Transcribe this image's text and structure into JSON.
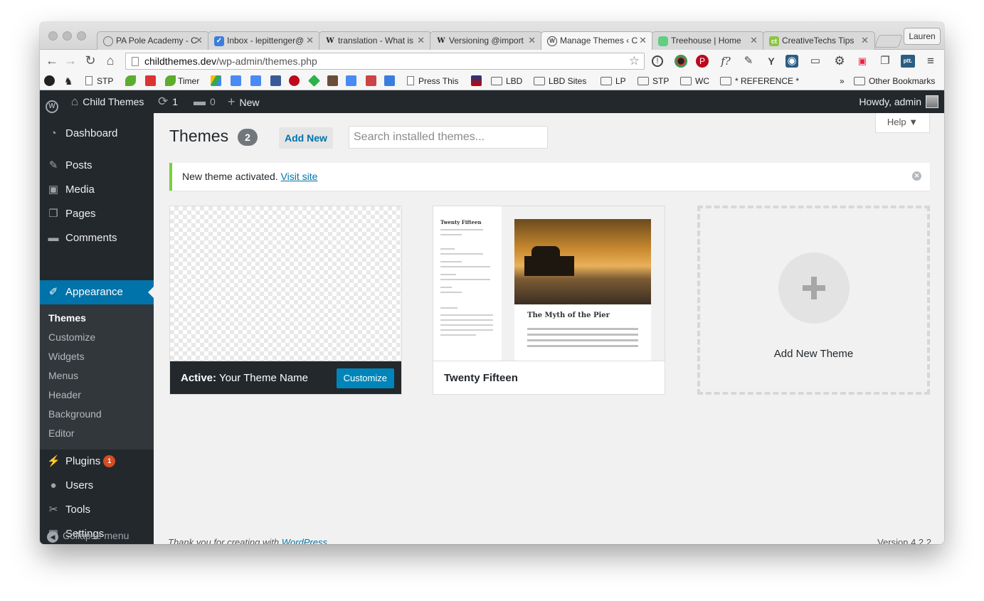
{
  "browser": {
    "profile_name": "Lauren",
    "tabs": [
      {
        "label": "PA Pole Academy - C",
        "icon": "globe-icon",
        "icon_color": "#777777"
      },
      {
        "label": "Inbox - lepittenger@",
        "icon": "inbox-icon",
        "icon_color": "#3b7ddd"
      },
      {
        "label": "translation - What is",
        "icon": "wikipedia-icon",
        "icon_color": "#555555"
      },
      {
        "label": "Versioning @import",
        "icon": "wikipedia-icon",
        "icon_color": "#555555"
      },
      {
        "label": "Manage Themes ‹ C",
        "icon": "wordpress-icon",
        "icon_color": "#464646"
      },
      {
        "label": "Treehouse | Home",
        "icon": "treehouse-icon",
        "icon_color": "#5fcf80"
      },
      {
        "label": "CreativeTechs Tips",
        "icon": "creativetechs-icon",
        "icon_color": "#8cc63f"
      }
    ],
    "url_host": "childthemes.dev",
    "url_path": "/wp-admin/themes.php",
    "bookmarks": {
      "stp1": "STP",
      "timer": "Timer",
      "press_this": "Press This",
      "lbd": "LBD",
      "lbd_sites": "LBD Sites",
      "lp": "LP",
      "stp2": "STP",
      "wc": "WC",
      "reference": "* REFERENCE *",
      "overflow": "»",
      "other": "Other Bookmarks"
    }
  },
  "adminbar": {
    "site_name": "Child Themes",
    "updates_count": "1",
    "comments_count": "0",
    "new_label": "New",
    "howdy": "Howdy, admin"
  },
  "sidebar": {
    "dashboard": "Dashboard",
    "posts": "Posts",
    "media": "Media",
    "pages": "Pages",
    "comments": "Comments",
    "appearance": "Appearance",
    "submenu": [
      "Themes",
      "Customize",
      "Widgets",
      "Menus",
      "Header",
      "Background",
      "Editor"
    ],
    "plugins": "Plugins",
    "plugins_badge": "1",
    "users": "Users",
    "tools": "Tools",
    "settings": "Settings",
    "collapse": "Collapse menu"
  },
  "main": {
    "help_label": "Help ▼",
    "title": "Themes",
    "theme_count": "2",
    "add_new_label": "Add New",
    "search_placeholder": "Search installed themes...",
    "notice_text": "New theme activated.",
    "notice_link": "Visit site",
    "active_prefix": "Active:",
    "active_theme_name": "Your Theme Name",
    "customize_label": "Customize",
    "theme2_name": "Twenty Fifteen",
    "theme2_preview_title": "Twenty Fifteen",
    "theme2_preview_post": "The Myth of the Pier",
    "add_new_theme_label": "Add New Theme",
    "footer_text": "Thank you for creating with",
    "footer_link": "WordPress",
    "version": "Version 4.2.2"
  },
  "colors": {
    "admin_bar_bg": "#23282d",
    "accent_blue": "#0073aa",
    "notice_success": "#7ad03a",
    "badge_orange": "#d54e21",
    "customize_button": "#0085ba"
  }
}
